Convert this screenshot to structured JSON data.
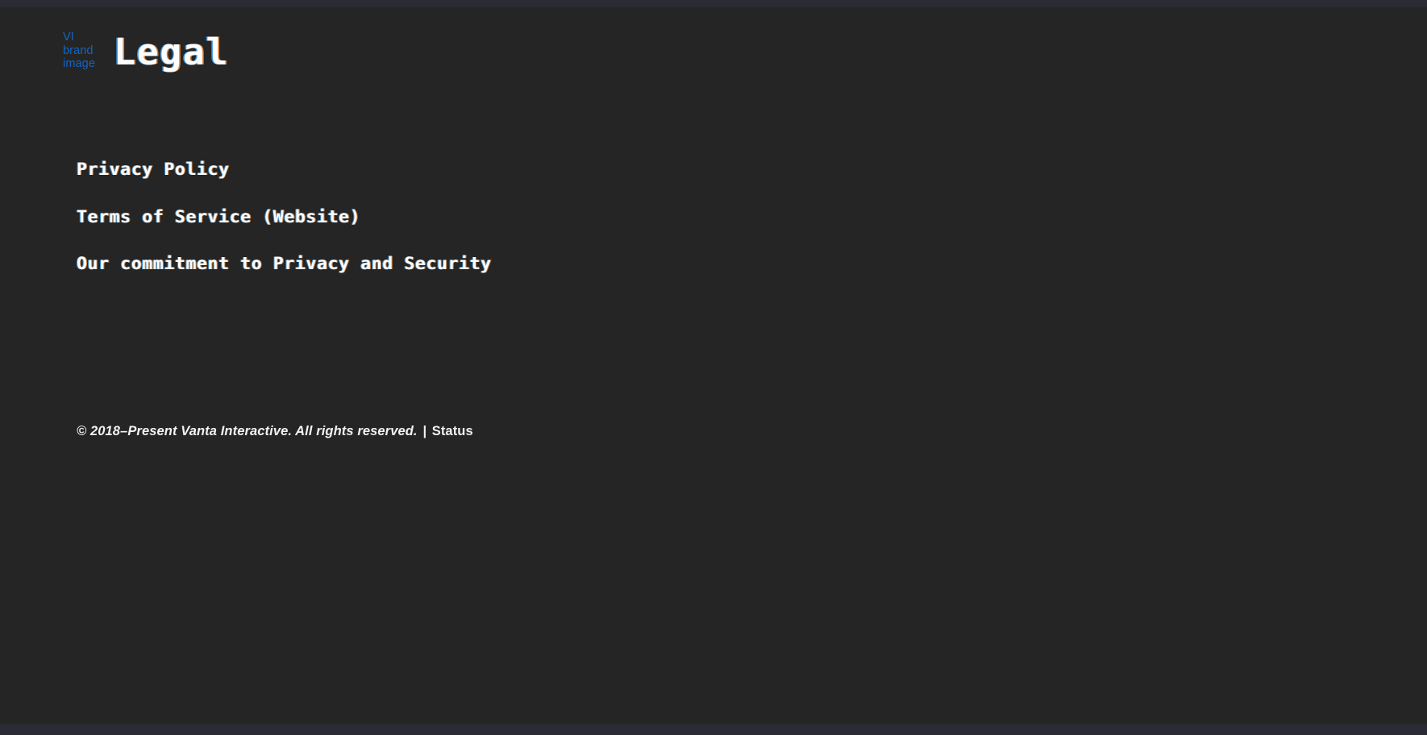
{
  "browser": {
    "top_strip_color": "#2b2b35",
    "bottom_strip_color": "#2b2b35"
  },
  "theme": {
    "background": "#252525",
    "text": "#fdfdfd",
    "brand_blue": "#1565c0",
    "aberration_left": "#38a8ff",
    "aberration_right": "#ff963c"
  },
  "header": {
    "logo_alt_text": "VI\nbrand\nimage",
    "title": "Legal"
  },
  "main": {
    "links": [
      {
        "label": "Privacy Policy"
      },
      {
        "label": "Terms of Service (Website)"
      },
      {
        "label": "Our commitment to Privacy and Security"
      }
    ]
  },
  "footer": {
    "copyright": "© 2018–Present Vanta Interactive. All rights reserved.",
    "separator": " | ",
    "status_label": "Status"
  }
}
